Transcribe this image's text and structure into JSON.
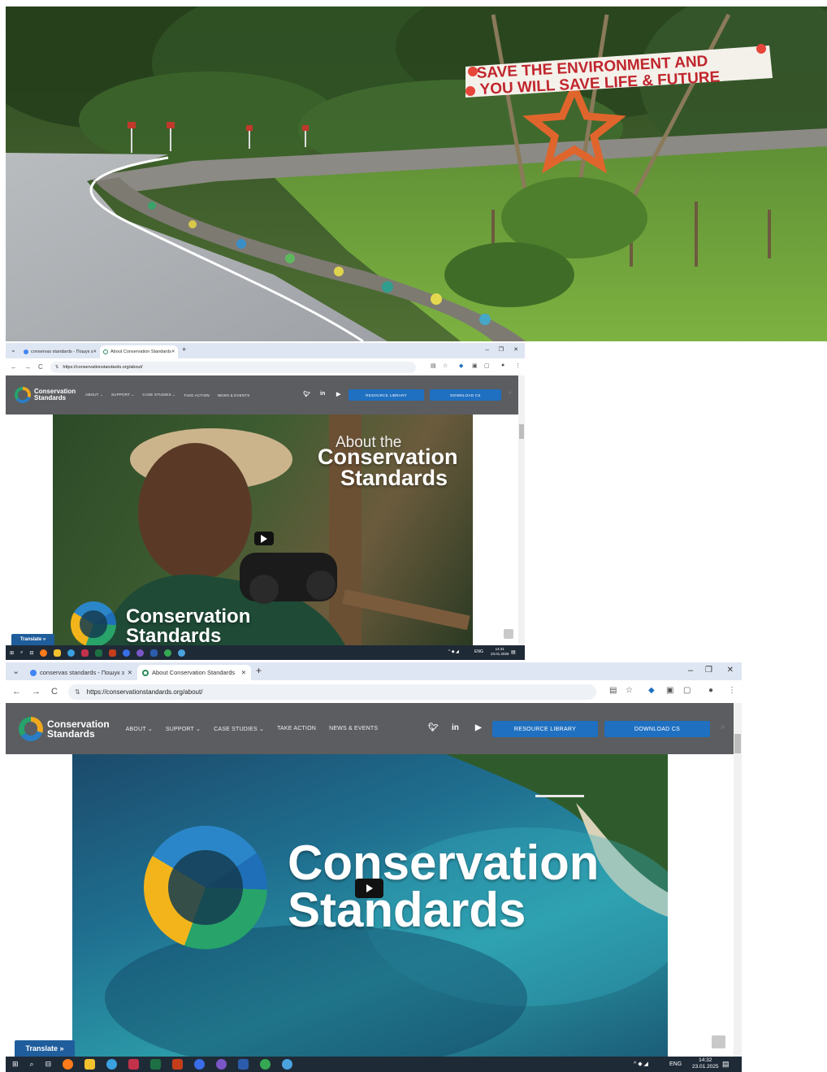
{
  "photo": {
    "sign_line1": "SAVE THE ENVIRONMENT AND",
    "sign_line2": "YOU WILL SAVE LIFE & FUTURE"
  },
  "browser1": {
    "tabs": [
      {
        "label": "conservas standards - Пошук з",
        "active": false
      },
      {
        "label": "About Conservation Standards",
        "active": true
      }
    ],
    "url": "https://conservationstandards.org/about/",
    "site": {
      "logo_line1": "Conservation",
      "logo_line2": "Standards",
      "menu": [
        "ABOUT",
        "SUPPORT",
        "CASE STUDIES",
        "TAKE ACTION",
        "NEWS & EVENTS"
      ],
      "resource_btn": "RESOURCE LIBRARY",
      "download_btn": "DOWNLOAD CS"
    },
    "hero": {
      "line1": "About the",
      "line2": "Conservation",
      "line3": "Standards",
      "bottom_line1": "Conservation",
      "bottom_line2": "Standards"
    },
    "translate": "Translate »",
    "tray": {
      "lang": "ENG",
      "time": "14:31",
      "date": "23.01.2025"
    }
  },
  "browser2": {
    "tabs": [
      {
        "label": "conservas standards - Пошук з",
        "active": false
      },
      {
        "label": "About Conservation Standards",
        "active": true
      }
    ],
    "url": "https://conservationstandards.org/about/",
    "site": {
      "logo_line1": "Conservation",
      "logo_line2": "Standards",
      "menu": [
        "ABOUT",
        "SUPPORT",
        "CASE STUDIES",
        "TAKE ACTION",
        "NEWS & EVENTS"
      ],
      "resource_btn": "RESOURCE LIBRARY",
      "download_btn": "DOWNLOAD CS"
    },
    "hero": {
      "line1": "Conservation",
      "line2": "Standards"
    },
    "translate": "Translate »",
    "tray": {
      "lang": "ENG",
      "time": "14:32",
      "date": "23.01.2025"
    }
  },
  "colors": {
    "nav_bg": "#5b5d60",
    "button_blue": "#1f70c1",
    "taskbar": "#1f2a37",
    "tabbar": "#dfe6f3"
  }
}
